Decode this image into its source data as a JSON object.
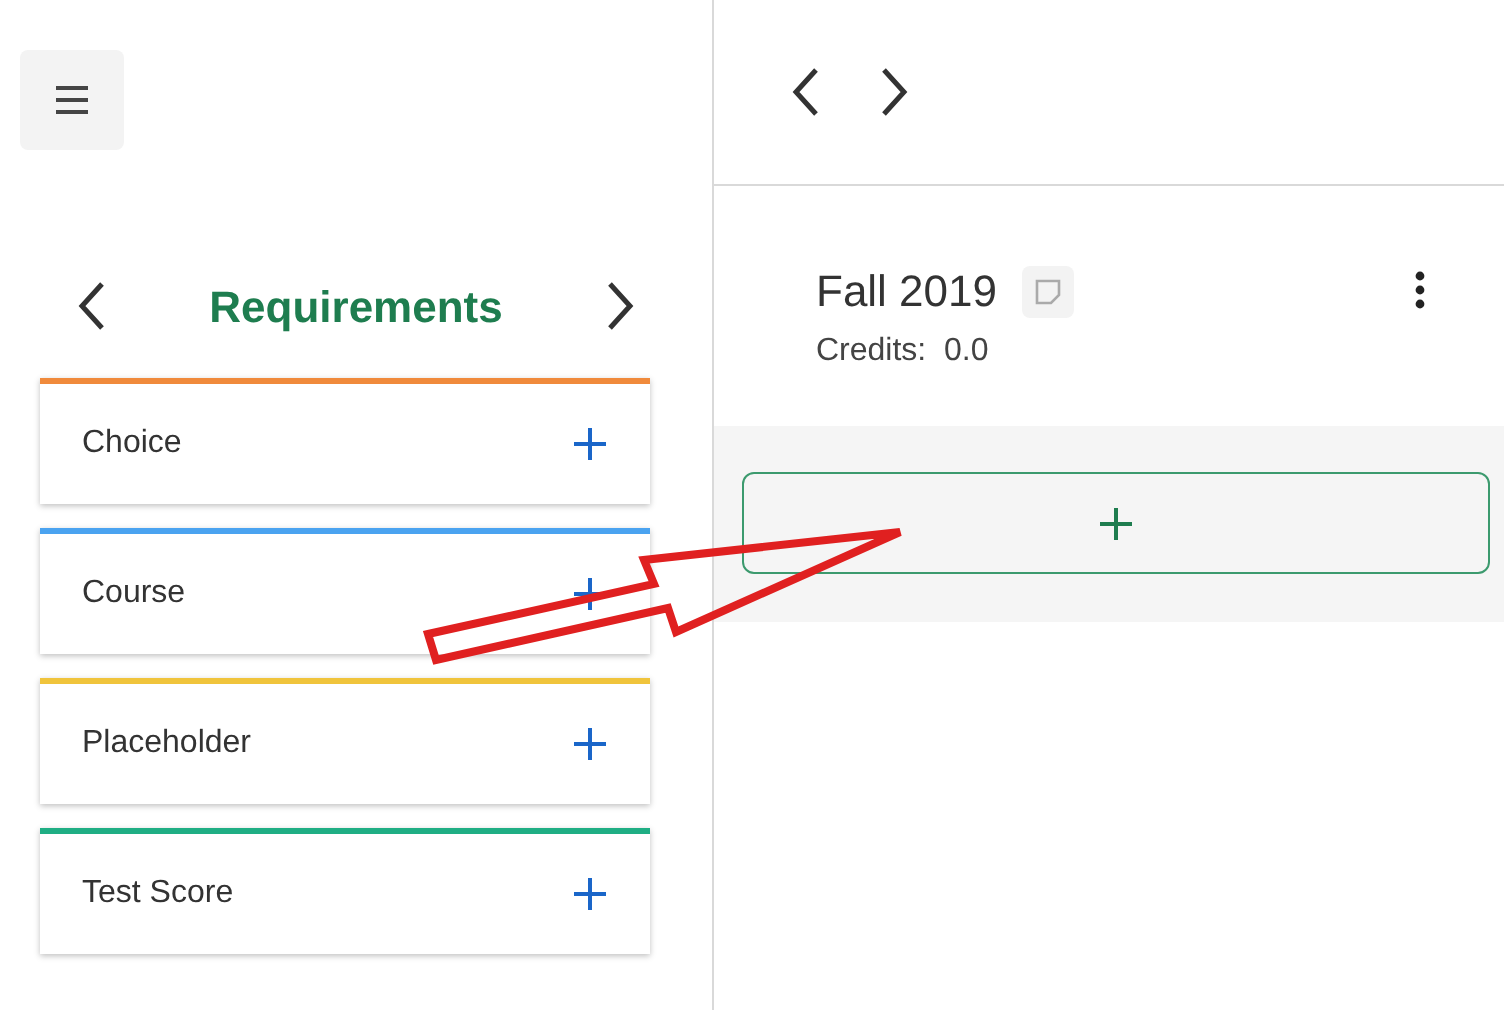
{
  "sidebar": {
    "title": "Requirements",
    "items": [
      {
        "label": "Choice",
        "color": "#f08a3c"
      },
      {
        "label": "Course",
        "color": "#4aa3f0"
      },
      {
        "label": "Placeholder",
        "color": "#f0c43c"
      },
      {
        "label": "Test Score",
        "color": "#1fae84"
      }
    ]
  },
  "term": {
    "title": "Fall 2019",
    "credits": "Credits:  0.0"
  }
}
